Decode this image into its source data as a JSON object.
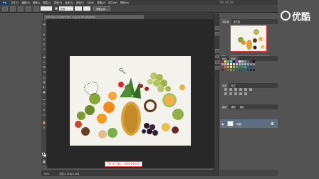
{
  "app": {
    "logo_text": "Ps",
    "menu": [
      "文件(F)",
      "编辑(E)",
      "图像(I)",
      "图层(L)",
      "类型(Y)",
      "选择(S)",
      "滤镜(T)",
      "3D(D)",
      "视图(V)",
      "窗口(W)",
      "帮助(H)"
    ]
  },
  "options_bar": {
    "label_sample": "正常",
    "button_refine": "调整边缘..."
  },
  "document": {
    "tab_title": "HMTLU23_1740BH1000_1.jpg @ 50%(RGB/8#)"
  },
  "watermark": {
    "qq_group": "PS 学习群：338035631",
    "brand": "优酷"
  },
  "status": {
    "zoom": "50%",
    "doc_size": "文档:2.12M/2.12M"
  },
  "panels": {
    "navigator_tabs": [
      "导航器",
      "直方图"
    ],
    "swatches_tabs": [
      "颜色",
      "色板"
    ],
    "adjust_tabs": [
      "调整",
      "样式"
    ],
    "layers_tabs": [
      "图层",
      "通道",
      "路径"
    ],
    "nav_zoom": "50%",
    "layer_name": "背景"
  },
  "colors": {
    "accent": "#5e6f83",
    "badge_border": "#e44",
    "canvas_bg": "#f4f3ee"
  }
}
